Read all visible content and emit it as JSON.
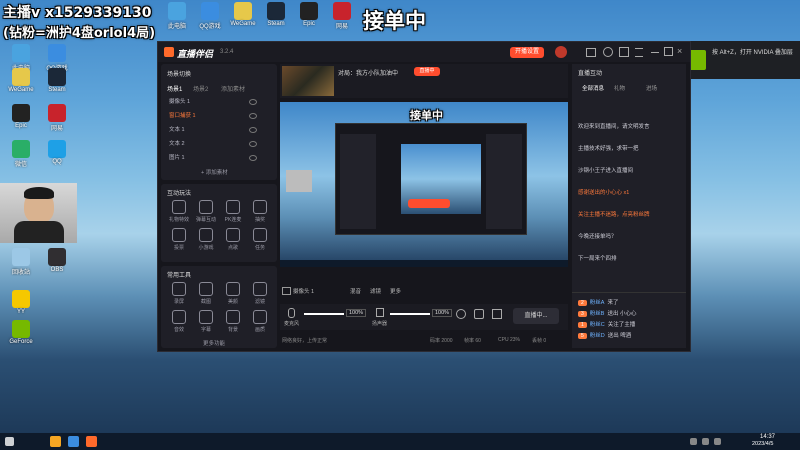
{
  "overlay": {
    "streamer_line1": "主播v x1529339130",
    "streamer_line2": "(钻粉=洲护4盘orlol4局)",
    "status_banner": "接单中"
  },
  "desktop_icons": [
    {
      "label": "此电脑",
      "color": "#4aa3df"
    },
    {
      "label": "QQ游戏",
      "color": "#3b8de0"
    },
    {
      "label": "WeGame",
      "color": "#e6c84a"
    },
    {
      "label": "Steam",
      "color": "#1b2838"
    },
    {
      "label": "Epic",
      "color": "#222222"
    },
    {
      "label": "网易",
      "color": "#c8232c"
    },
    {
      "label": "微信",
      "color": "#2aae67"
    },
    {
      "label": "QQ",
      "color": "#1ea0e6"
    },
    {
      "label": "回收站",
      "color": "#9cc8e6"
    },
    {
      "label": "OBS",
      "color": "#302e31"
    },
    {
      "label": "YY",
      "color": "#f5c800"
    },
    {
      "label": "GeForce",
      "color": "#76b900"
    }
  ],
  "app": {
    "title": "直播伴侣",
    "version": "3.2.4",
    "top_right_button": "开播设置",
    "scene_header": "场景切换",
    "scene_tabs": [
      "场景1",
      "场景2"
    ],
    "sources_header": "添加素材",
    "sources": [
      "摄像头 1",
      "窗口捕获 1",
      "文本 1",
      "文本 2",
      "图片 1"
    ],
    "add_source_label": "+ 添加素材",
    "tools_header": "互动玩法",
    "tools": [
      "礼物特效",
      "弹幕互动",
      "PK连麦",
      "抽奖",
      "投票",
      "小游戏",
      "点歌",
      "任务"
    ],
    "tools2_header": "常用工具",
    "tools2": [
      "录屏",
      "截图",
      "美颜",
      "滤镜",
      "音效",
      "字幕",
      "背景",
      "画质"
    ],
    "more_label": "更多功能",
    "game_title": "对局：我方小队加油中",
    "live_tag": "直播中",
    "mic_label": "麦克风",
    "mic_volume": "100%",
    "speaker_label": "扬声器",
    "speaker_volume": "100%",
    "live_button": "直播中...",
    "bottom_bar_left": "网络良好，上传正常",
    "bottom_stats": [
      "码率 2000",
      "帧率 60",
      "CPU 23%",
      "丢帧 0"
    ],
    "scene_source_label": "摄像头 1",
    "bottom_tabs": [
      "混音",
      "滤镜",
      "更多"
    ]
  },
  "right_panel": {
    "header": "直播互动",
    "tabs": [
      "全部消息",
      "礼物",
      "进场"
    ],
    "messages": [
      {
        "text": "欢迎来到直播间，请文明发言",
        "highlight": false
      },
      {
        "text": "主播技术好强，求带一把",
        "highlight": false
      },
      {
        "text": "沙钢小王子进入直播间",
        "highlight": false
      },
      {
        "text": "感谢送出的小心心 x1",
        "highlight": true
      },
      {
        "text": "关注主播不迷路，点亮粉丝牌",
        "highlight": true
      },
      {
        "text": "今晚还接单吗？",
        "highlight": false
      },
      {
        "text": "下一局来个四排",
        "highlight": false
      }
    ],
    "gifts": [
      {
        "badge": "2",
        "name": "粉丝A",
        "text": "来了"
      },
      {
        "badge": "3",
        "name": "粉丝B",
        "text": "送出 小心心"
      },
      {
        "badge": "1",
        "name": "粉丝C",
        "text": "关注了主播"
      },
      {
        "badge": "5",
        "name": "粉丝D",
        "text": "送出 啤酒"
      }
    ]
  },
  "notification": {
    "text": "按 Alt+Z，打开 NVIDIA 叠加层"
  },
  "taskbar": {
    "time": "14:37",
    "date": "2023/4/5"
  }
}
